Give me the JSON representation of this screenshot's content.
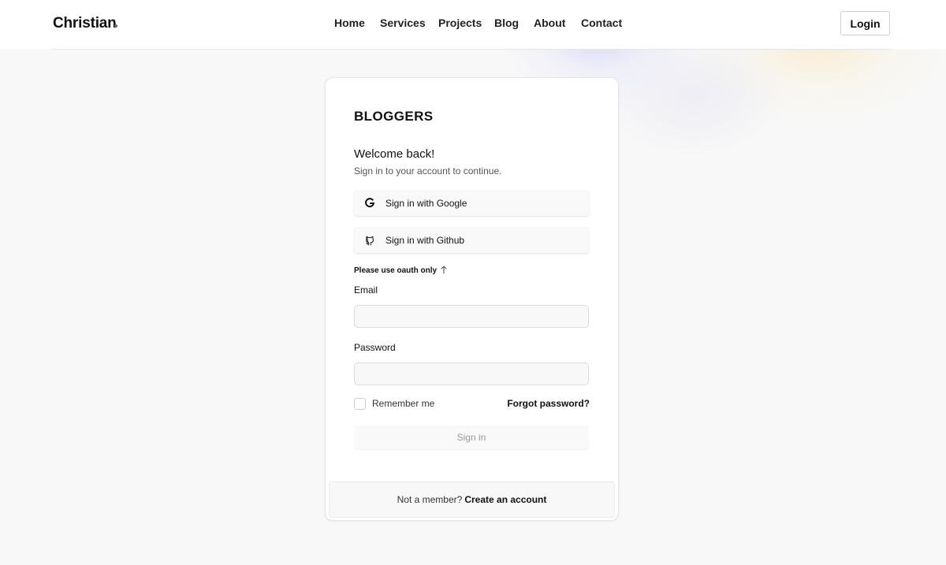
{
  "header": {
    "logo": "Christian",
    "nav": [
      "Home",
      "Services",
      "Projects",
      "Blog",
      "About",
      "Contact"
    ],
    "login_label": "Login"
  },
  "card": {
    "brand": "BLOGGERS",
    "welcome": "Welcome back!",
    "subtitle": "Sign in to your account to continue.",
    "google_label": "Sign in with Google",
    "github_label": "Sign in with Github",
    "oauth_note": "Please use oauth only",
    "email_label": "Email",
    "email_value": "",
    "password_label": "Password",
    "password_value": "",
    "remember_label": "Remember me",
    "remember_checked": false,
    "forgot_label": "Forgot password?",
    "signin_label": "Sign in",
    "footer_text": "Not a member?",
    "footer_link": "Create an account"
  }
}
